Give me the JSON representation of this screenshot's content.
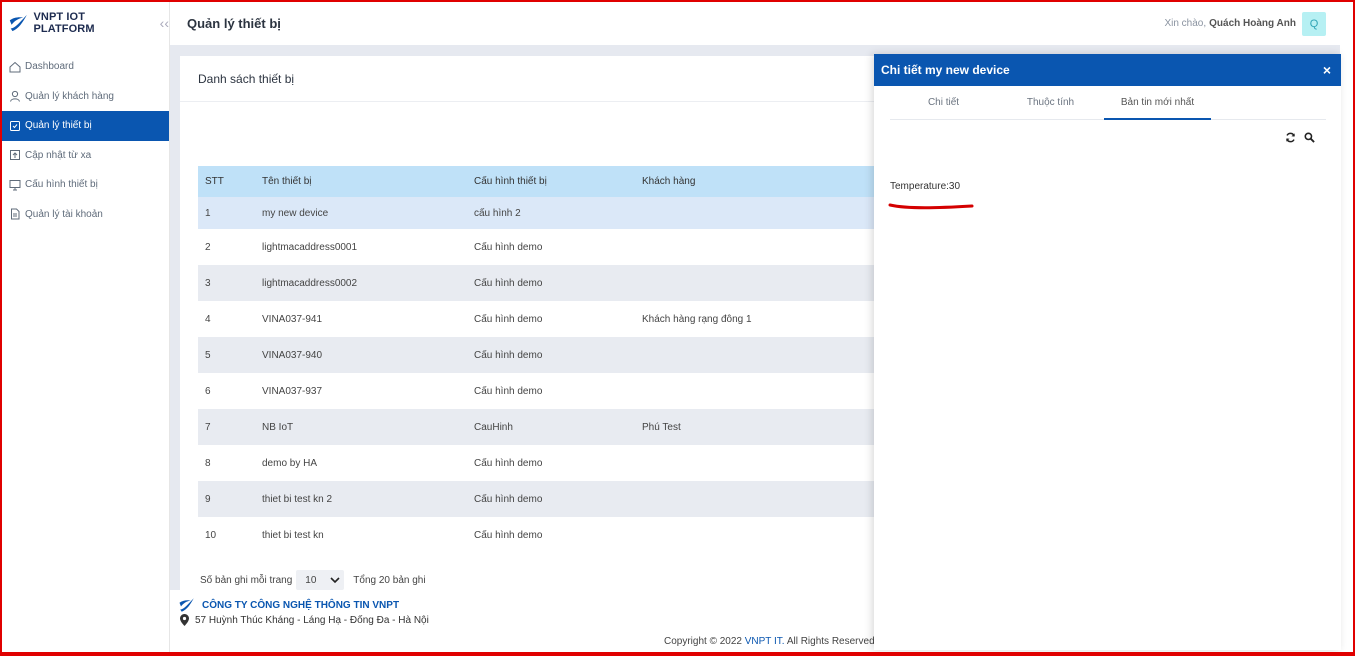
{
  "brand": {
    "name": "VNPT IOT PLATFORM"
  },
  "sidebar": {
    "items": [
      {
        "label": "Dashboard",
        "icon": "home-icon",
        "active": false
      },
      {
        "label": "Quản lý khách hàng",
        "icon": "user-icon",
        "active": false
      },
      {
        "label": "Quản lý thiết bị",
        "icon": "device-icon",
        "active": true
      },
      {
        "label": "Cập nhật từ xa",
        "icon": "upload-icon",
        "active": false
      },
      {
        "label": "Cấu hình thiết bị",
        "icon": "monitor-icon",
        "active": false
      },
      {
        "label": "Quản lý tài khoản",
        "icon": "file-icon",
        "active": false
      }
    ]
  },
  "header": {
    "title": "Quản lý thiết bị",
    "greeting": "Xin chào,",
    "user_name": "Quách Hoàng Anh",
    "avatar_letter": "Q"
  },
  "device_list": {
    "title": "Danh sách thiết bị",
    "columns": [
      "STT",
      "Tên thiết bị",
      "Cấu hình thiết bị",
      "Khách hàng"
    ],
    "rows": [
      [
        "1",
        "my new device",
        "cấu hình 2",
        ""
      ],
      [
        "2",
        "lightmacaddress0001",
        "Cấu hình demo",
        ""
      ],
      [
        "3",
        "lightmacaddress0002",
        "Cấu hình demo",
        ""
      ],
      [
        "4",
        "VINA037-941",
        "Cấu hình demo",
        "Khách hàng rạng đông 1"
      ],
      [
        "5",
        "VINA037-940",
        "Cấu hình demo",
        ""
      ],
      [
        "6",
        "VINA037-937",
        "Cấu hình demo",
        ""
      ],
      [
        "7",
        "NB IoT",
        "CauHinh",
        "Phú Test"
      ],
      [
        "8",
        "demo by HA",
        "Cấu hình demo",
        ""
      ],
      [
        "9",
        "thiet bi test kn 2",
        "Cấu hình demo",
        ""
      ],
      [
        "10",
        "thiet bi test kn",
        "Cấu hình demo",
        ""
      ]
    ],
    "page_size_label": "Số bản ghi mỗi trang",
    "page_size": "10",
    "total_label": "Tổng 20 bản ghi"
  },
  "footer": {
    "company": "CÔNG TY CÔNG NGHỆ THÔNG TIN VNPT",
    "address": "57 Huỳnh Thúc Kháng - Láng Hạ - Đống Đa - Hà Nội",
    "copyright_prefix": "Copyright © 2022",
    "copyright_brand": "VNPT IT.",
    "copyright_suffix": "All Rights Reserved"
  },
  "detail_panel": {
    "title": "Chi tiết my new device",
    "close": "×",
    "tabs": [
      {
        "label": "Chi tiết",
        "active": false
      },
      {
        "label": "Thuộc tính",
        "active": false
      },
      {
        "label": "Bản tin mới nhất",
        "active": true
      }
    ],
    "telemetry": "Temperature:30"
  },
  "colors": {
    "primary": "#0a56b0",
    "table_header": "#bfe1f8",
    "row_alt": "#e8ebf1",
    "row_highlight": "#dbe8f8",
    "annotation": "#d40000"
  }
}
